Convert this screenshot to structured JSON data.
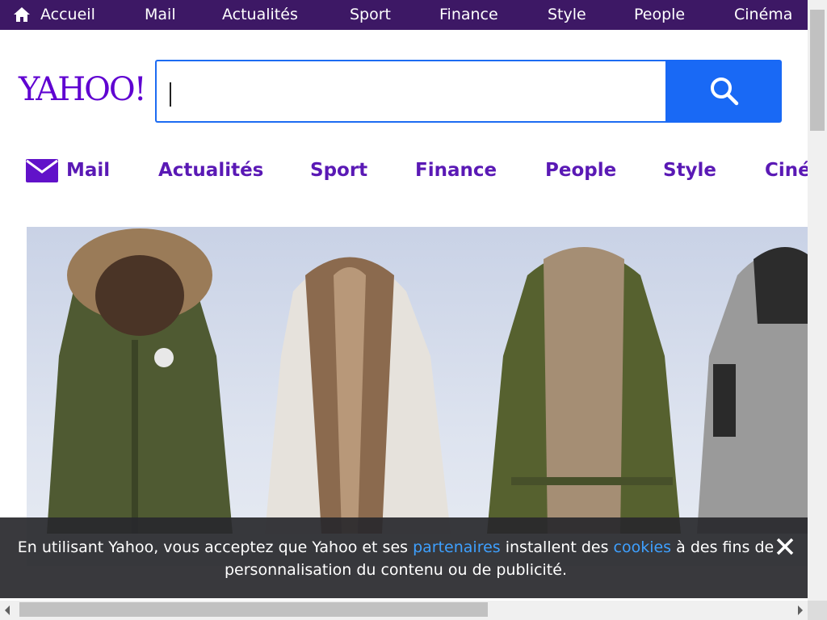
{
  "top_nav": {
    "home_label": "Accueil",
    "items": [
      "Mail",
      "Actualités",
      "Sport",
      "Finance",
      "Style",
      "People",
      "Cinéma"
    ],
    "background": "#3d1865"
  },
  "logo": {
    "text": "YAHOO!",
    "color": "#5f01d1"
  },
  "search": {
    "value": "",
    "button_icon": "search-icon",
    "accent": "#1969f5"
  },
  "secondary_nav": {
    "mail_label": "Mail",
    "items": [
      "Actualités",
      "Sport",
      "Finance",
      "People",
      "Style",
      "Ciné"
    ],
    "color": "#5a19b5"
  },
  "hero": {
    "image": "winter parka coats promotion"
  },
  "cookie_banner": {
    "part1": "En utilisant Yahoo, vous acceptez que Yahoo et ses ",
    "link1": "partenaires",
    "part2": " installent des ",
    "link2": "cookies",
    "part3": " à des fins de personnalisation du contenu ou de publicité.",
    "close_icon": "close-icon"
  }
}
